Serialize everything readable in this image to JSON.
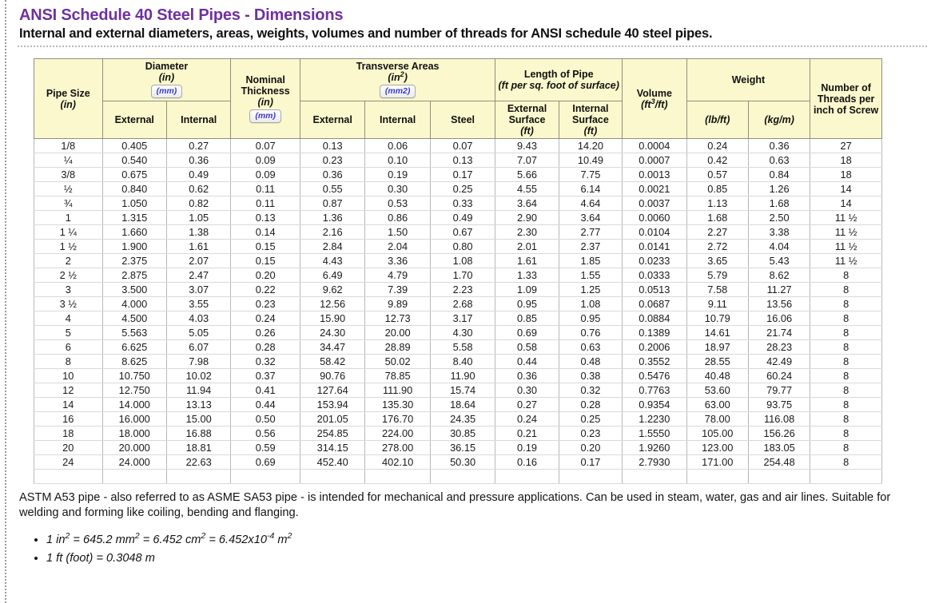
{
  "header": {
    "title": "ANSI Schedule 40 Steel Pipes - Dimensions",
    "subtitle": "Internal and external diameters, areas, weights, volumes and number of threads for ANSI schedule 40 steel pipes."
  },
  "table": {
    "groups": {
      "pipe_size": "Pipe Size",
      "pipe_size_unit": "(in)",
      "diameter": "Diameter",
      "diameter_unit": "(in)",
      "diameter_button": "(mm)",
      "nominal_thickness": "Nominal Thickness",
      "nominal_thickness_unit": "(in)",
      "nominal_thickness_button": "(mm)",
      "transverse_areas": "Transverse Areas",
      "transverse_areas_unit_pre": "(in",
      "transverse_areas_unit_sup": "2",
      "transverse_areas_unit_post": ")",
      "transverse_areas_button": "(mm2)",
      "length_of_pipe": "Length of Pipe",
      "length_of_pipe_unit": "(ft per sq. foot of surface)",
      "volume": "Volume",
      "volume_unit_pre": "(ft",
      "volume_unit_sup": "3",
      "volume_unit_post": "/ft)",
      "weight": "Weight",
      "threads": "Number of Threads per inch of Screw"
    },
    "subheaders": {
      "diameter_external": "External",
      "diameter_internal": "Internal",
      "area_external": "External",
      "area_internal": "Internal",
      "area_steel": "Steel",
      "length_external": "External Surface",
      "length_external_unit": "(ft)",
      "length_internal": "Internal Surface",
      "length_internal_unit": "(ft)",
      "weight_lb": "(lb/ft)",
      "weight_kg": "(kg/m)"
    },
    "rows": [
      [
        "1/8",
        "0.405",
        "0.27",
        "0.07",
        "0.13",
        "0.06",
        "0.07",
        "9.43",
        "14.20",
        "0.0004",
        "0.24",
        "0.36",
        "27"
      ],
      [
        "¼",
        "0.540",
        "0.36",
        "0.09",
        "0.23",
        "0.10",
        "0.13",
        "7.07",
        "10.49",
        "0.0007",
        "0.42",
        "0.63",
        "18"
      ],
      [
        "3/8",
        "0.675",
        "0.49",
        "0.09",
        "0.36",
        "0.19",
        "0.17",
        "5.66",
        "7.75",
        "0.0013",
        "0.57",
        "0.84",
        "18"
      ],
      [
        "½",
        "0.840",
        "0.62",
        "0.11",
        "0.55",
        "0.30",
        "0.25",
        "4.55",
        "6.14",
        "0.0021",
        "0.85",
        "1.26",
        "14"
      ],
      [
        "¾",
        "1.050",
        "0.82",
        "0.11",
        "0.87",
        "0.53",
        "0.33",
        "3.64",
        "4.64",
        "0.0037",
        "1.13",
        "1.68",
        "14"
      ],
      [
        "1",
        "1.315",
        "1.05",
        "0.13",
        "1.36",
        "0.86",
        "0.49",
        "2.90",
        "3.64",
        "0.0060",
        "1.68",
        "2.50",
        "11 ½"
      ],
      [
        "1 ¼",
        "1.660",
        "1.38",
        "0.14",
        "2.16",
        "1.50",
        "0.67",
        "2.30",
        "2.77",
        "0.0104",
        "2.27",
        "3.38",
        "11 ½"
      ],
      [
        "1 ½",
        "1.900",
        "1.61",
        "0.15",
        "2.84",
        "2.04",
        "0.80",
        "2.01",
        "2.37",
        "0.0141",
        "2.72",
        "4.04",
        "11 ½"
      ],
      [
        "2",
        "2.375",
        "2.07",
        "0.15",
        "4.43",
        "3.36",
        "1.08",
        "1.61",
        "1.85",
        "0.0233",
        "3.65",
        "5.43",
        "11 ½"
      ],
      [
        "2 ½",
        "2.875",
        "2.47",
        "0.20",
        "6.49",
        "4.79",
        "1.70",
        "1.33",
        "1.55",
        "0.0333",
        "5.79",
        "8.62",
        "8"
      ],
      [
        "3",
        "3.500",
        "3.07",
        "0.22",
        "9.62",
        "7.39",
        "2.23",
        "1.09",
        "1.25",
        "0.0513",
        "7.58",
        "11.27",
        "8"
      ],
      [
        "3 ½",
        "4.000",
        "3.55",
        "0.23",
        "12.56",
        "9.89",
        "2.68",
        "0.95",
        "1.08",
        "0.0687",
        "9.11",
        "13.56",
        "8"
      ],
      [
        "4",
        "4.500",
        "4.03",
        "0.24",
        "15.90",
        "12.73",
        "3.17",
        "0.85",
        "0.95",
        "0.0884",
        "10.79",
        "16.06",
        "8"
      ],
      [
        "5",
        "5.563",
        "5.05",
        "0.26",
        "24.30",
        "20.00",
        "4.30",
        "0.69",
        "0.76",
        "0.1389",
        "14.61",
        "21.74",
        "8"
      ],
      [
        "6",
        "6.625",
        "6.07",
        "0.28",
        "34.47",
        "28.89",
        "5.58",
        "0.58",
        "0.63",
        "0.2006",
        "18.97",
        "28.23",
        "8"
      ],
      [
        "8",
        "8.625",
        "7.98",
        "0.32",
        "58.42",
        "50.02",
        "8.40",
        "0.44",
        "0.48",
        "0.3552",
        "28.55",
        "42.49",
        "8"
      ],
      [
        "10",
        "10.750",
        "10.02",
        "0.37",
        "90.76",
        "78.85",
        "11.90",
        "0.36",
        "0.38",
        "0.5476",
        "40.48",
        "60.24",
        "8"
      ],
      [
        "12",
        "12.750",
        "11.94",
        "0.41",
        "127.64",
        "111.90",
        "15.74",
        "0.30",
        "0.32",
        "0.7763",
        "53.60",
        "79.77",
        "8"
      ],
      [
        "14",
        "14.000",
        "13.13",
        "0.44",
        "153.94",
        "135.30",
        "18.64",
        "0.27",
        "0.28",
        "0.9354",
        "63.00",
        "93.75",
        "8"
      ],
      [
        "16",
        "16.000",
        "15.00",
        "0.50",
        "201.05",
        "176.70",
        "24.35",
        "0.24",
        "0.25",
        "1.2230",
        "78.00",
        "116.08",
        "8"
      ],
      [
        "18",
        "18.000",
        "16.88",
        "0.56",
        "254.85",
        "224.00",
        "30.85",
        "0.21",
        "0.23",
        "1.5550",
        "105.00",
        "156.26",
        "8"
      ],
      [
        "20",
        "20.000",
        "18.81",
        "0.59",
        "314.15",
        "278.00",
        "36.15",
        "0.19",
        "0.20",
        "1.9260",
        "123.00",
        "183.05",
        "8"
      ],
      [
        "24",
        "24.000",
        "22.63",
        "0.69",
        "452.40",
        "402.10",
        "50.30",
        "0.16",
        "0.17",
        "2.7930",
        "171.00",
        "254.48",
        "8"
      ]
    ]
  },
  "footer": {
    "note": "ASTM A53 pipe - also referred to as ASME SA53 pipe - is intended for mechanical and pressure applications. Can be used in steam, water, gas and air lines. Suitable for welding and forming like coiling, bending and flanging.",
    "bullets": [
      {
        "pre": "1 in",
        "sup1": "2",
        "mid1": " = 645.2 mm",
        "sup2": "2",
        "mid2": " = 6.452 cm",
        "sup3": "2",
        "mid3": " = 6.452x10",
        "sup4": "-4",
        "post": " m",
        "sup5": "2"
      },
      {
        "text": "1 ft (foot) = 0.3048 m"
      }
    ]
  },
  "colors": {
    "title": "#7030a0",
    "header_bg": "#fbf8cd",
    "button_text": "#3a3ad0"
  }
}
